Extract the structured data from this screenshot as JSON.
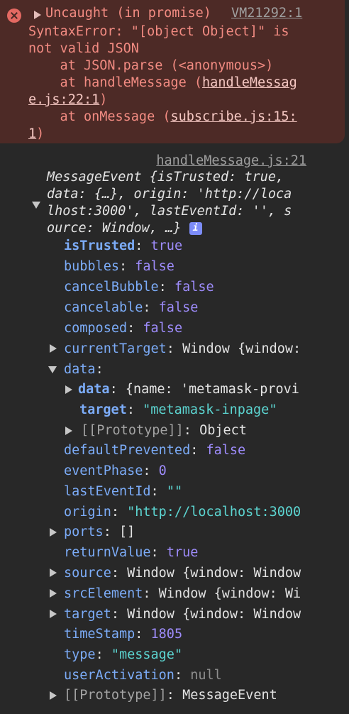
{
  "error": {
    "title": "Uncaught (in promise)",
    "source_link": "VM21292:1",
    "message_line1": "SyntaxError: \"[object Object]\" is",
    "message_line2": "not valid JSON",
    "stack": {
      "frame1": "    at JSON.parse (<anonymous>)",
      "frame2_prefix": "    at handleMessage (",
      "frame2_link_a": "handleMessag",
      "frame2_link_b": "e.js:22:1",
      "frame2_suffix": ")",
      "frame3_prefix": "    at onMessage (",
      "frame3_link_a": "subscribe.js:15:",
      "frame3_link_b": "1",
      "frame3_suffix": ")"
    }
  },
  "log": {
    "source_link": "handleMessage.js:21",
    "summary": {
      "line1": "MessageEvent {isTrusted: true,",
      "line2": "data: {…}, origin: 'http://loca",
      "line3": "lhost:3000', lastEventId: '', s",
      "line4": "ource: Window, …}",
      "info_badge": "i"
    },
    "props": [
      {
        "key": "isTrusted",
        "value": "true"
      },
      {
        "key": "bubbles",
        "value": "false"
      },
      {
        "key": "cancelBubble",
        "value": "false"
      },
      {
        "key": "cancelable",
        "value": "false"
      },
      {
        "key": "composed",
        "value": "false"
      },
      {
        "key": "currentTarget",
        "value": "Window {window:"
      },
      {
        "key": "data",
        "value": ""
      },
      {
        "key": "data",
        "value": "{name: 'metamask-provi"
      },
      {
        "key": "target",
        "value": "\"metamask-inpage\""
      },
      {
        "key": "[[Prototype]]",
        "value": "Object"
      },
      {
        "key": "defaultPrevented",
        "value": "false"
      },
      {
        "key": "eventPhase",
        "value": "0"
      },
      {
        "key": "lastEventId",
        "value": "\"\""
      },
      {
        "key": "origin",
        "value": "\"http://localhost:3000"
      },
      {
        "key": "ports",
        "value": "[]"
      },
      {
        "key": "returnValue",
        "value": "true"
      },
      {
        "key": "source",
        "value": "Window {window: Window"
      },
      {
        "key": "srcElement",
        "value": "Window {window: Wi"
      },
      {
        "key": "target",
        "value": "Window {window: Window"
      },
      {
        "key": "timeStamp",
        "value": "1805"
      },
      {
        "key": "type",
        "value": "\"message\""
      },
      {
        "key": "userActivation",
        "value": "null"
      },
      {
        "key": "[[Prototype]]",
        "value": "MessageEvent"
      }
    ]
  },
  "colors": {
    "background": "#282828",
    "error_bg": "#4d2a26",
    "error_text": "#f28b82",
    "key": "#7cacf8",
    "string": "#5cd5d1",
    "number_bool": "#9e8cfb"
  }
}
